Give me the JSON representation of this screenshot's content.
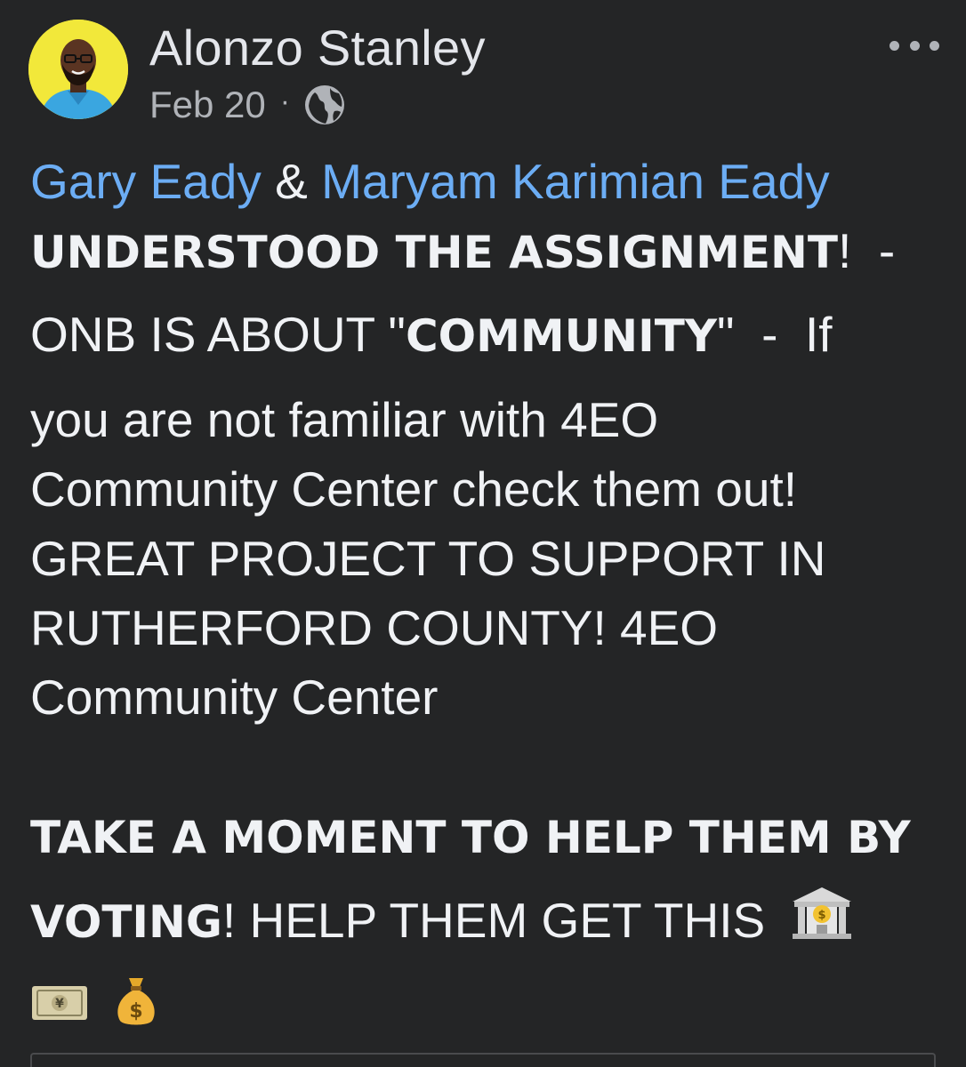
{
  "post": {
    "author": "Alonzo Stanley",
    "date": "Feb 20",
    "separator": "·",
    "visibility_icon": "globe-icon",
    "more_icon": "more-dots-icon",
    "mention_1": "Gary Eady",
    "amp": " & ",
    "mention_2": "Maryam Karimian Eady",
    "l2_bold": "UNDERSTOOD THE ASSIGNMENT",
    "l2_tail": "!  -",
    "l3_head": "ONB IS ABOUT \"",
    "l3_bold": "COMMUNITY",
    "l3_tail": "\"  -  If",
    "l4": "you are not familiar with 4EO",
    "l5": "Community Center check them out!",
    "l6": "GREAT PROJECT TO SUPPORT IN",
    "l7": "RUTHERFORD COUNTY!  4EO",
    "l8": "Community Center",
    "l9_bold": "TAKE A MOMENT TO HELP THEM BY",
    "l10_bold": "VOTING",
    "l10_tail": "! HELP THEM GET THIS",
    "emoji_bank": "bank-emoji",
    "emoji_yen": "yen-banknote-emoji",
    "emoji_moneybag": "money-bag-emoji"
  },
  "colors": {
    "background": "#242526",
    "text": "#f0f2f5",
    "link": "#6cadf4",
    "secondary": "#b0b3b8",
    "avatar_bg": "#f2e83a"
  }
}
